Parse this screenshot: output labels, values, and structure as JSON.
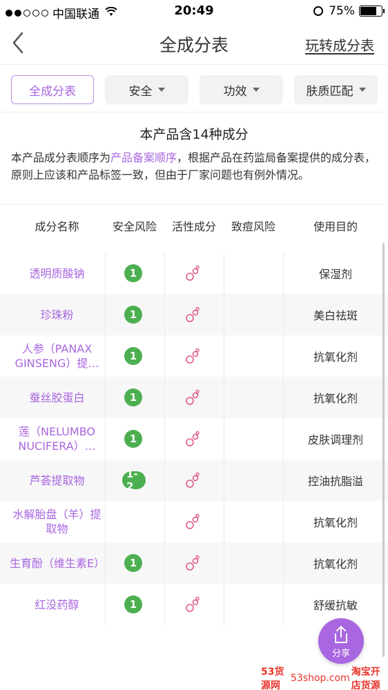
{
  "status_bar": {
    "carrier": "中国联通",
    "time": "20:49",
    "battery": "75%",
    "battery_level": 0.75
  },
  "header": {
    "title": "全成分表",
    "right_link": "玩转成分表"
  },
  "filters": [
    {
      "label": "全成分表",
      "active": true
    },
    {
      "label": "安全",
      "dropdown": true
    },
    {
      "label": "功效",
      "dropdown": true
    },
    {
      "label": "肤质匹配",
      "dropdown": true
    }
  ],
  "summary": {
    "title": "本产品含14种成分",
    "desc_prefix": "本产品成分表顺序为",
    "desc_link": "产品备案顺序",
    "desc_suffix": "，根据产品在药监局备案提供的成分表，原则上应该和产品标签一致，但由于厂家问题也有例外情况。"
  },
  "table": {
    "headers": [
      "成分名称",
      "安全风险",
      "活性成分",
      "致痘风险",
      "使用目的"
    ],
    "rows": [
      {
        "name": "透明质酸钠",
        "risk": "1",
        "active": true,
        "purpose": "保湿剂"
      },
      {
        "name": "珍珠粉",
        "risk": "1",
        "active": true,
        "purpose": "美白祛斑"
      },
      {
        "name": "人参（PANAX GINSENG）提…",
        "risk": "1",
        "active": true,
        "purpose": "抗氧化剂"
      },
      {
        "name": "蚕丝胶蛋白",
        "risk": "1",
        "active": true,
        "purpose": "抗氧化剂"
      },
      {
        "name": "莲（NELUMBO NUCIFERA）…",
        "risk": "1",
        "active": true,
        "purpose": "皮肤调理剂"
      },
      {
        "name": "芦荟提取物",
        "risk": "1-2",
        "active": true,
        "purpose": "控油抗脂溢"
      },
      {
        "name": "水解胎盘（羊）提取物",
        "risk": "",
        "active": true,
        "purpose": "抗氧化剂"
      },
      {
        "name": "生育酚（维生素E）",
        "risk": "1",
        "active": true,
        "purpose": "抗氧化剂"
      },
      {
        "name": "红没药醇",
        "risk": "1",
        "active": true,
        "purpose": "舒缓抗敏"
      }
    ]
  },
  "share_button": {
    "label": "分享"
  },
  "watermark": {
    "brand": "53货源网",
    "url": "53shop.com",
    "slogan": "淘宝开店货源"
  },
  "colors": {
    "accent": "#a866e0",
    "risk_green": "#4caf50",
    "active_pink": "#e05a8c"
  }
}
